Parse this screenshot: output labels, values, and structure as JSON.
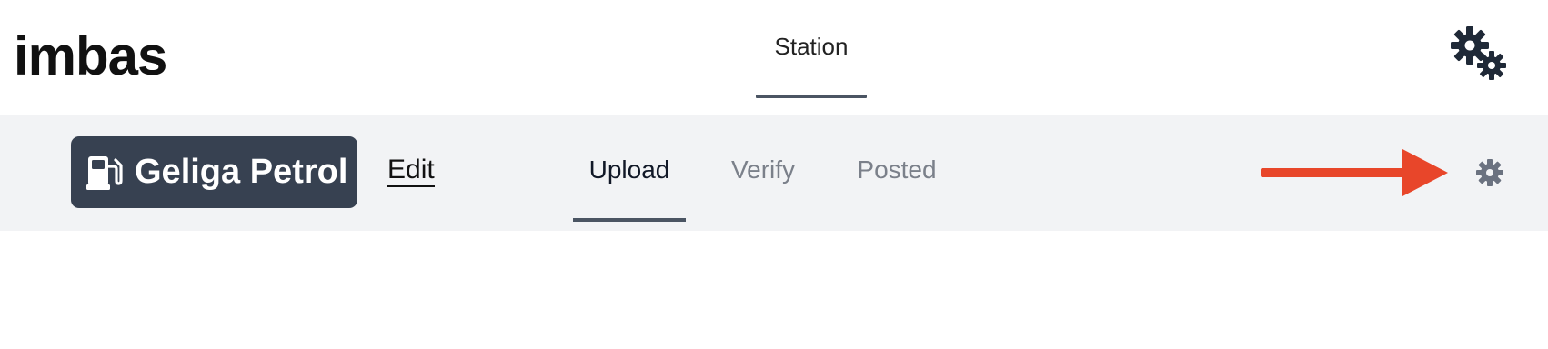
{
  "app": {
    "brand": "imbas"
  },
  "header": {
    "tabs": [
      {
        "label": "Station",
        "active": true
      }
    ],
    "settings_icon": "gears-icon"
  },
  "station_bar": {
    "station_name": "Geliga Petrol",
    "station_icon": "gas-pump-icon",
    "edit_label": "Edit",
    "tabs": [
      {
        "label": "Upload",
        "active": true
      },
      {
        "label": "Verify",
        "active": false
      },
      {
        "label": "Posted",
        "active": false
      }
    ],
    "annotation": "arrow-pointing-right",
    "settings_icon": "gear-icon"
  },
  "colors": {
    "badge_bg": "#374151",
    "subbar_bg": "#f2f3f5",
    "active_underline": "#4b5563",
    "inactive_tab": "#7b808a",
    "annotation_arrow": "#e8462a",
    "icon_dark": "#1f2937",
    "icon_muted": "#6b7280"
  }
}
